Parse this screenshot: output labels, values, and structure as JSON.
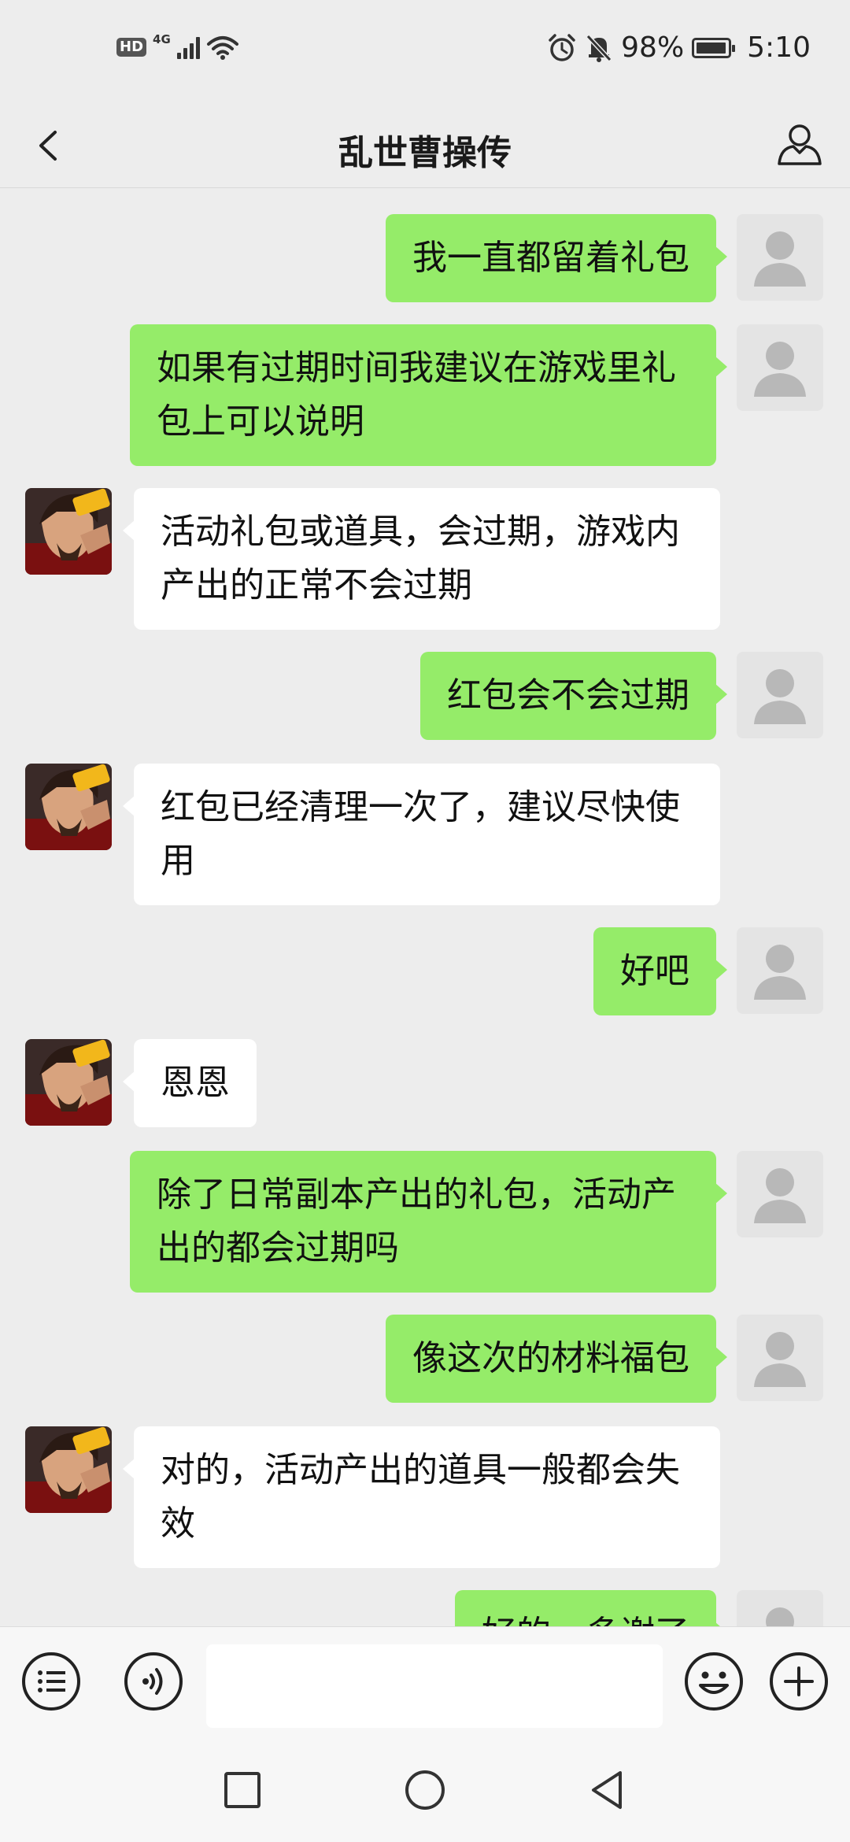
{
  "status_bar": {
    "left_badges": [
      "HD",
      "4G"
    ],
    "battery_percent": "98%",
    "battery_level": 0.98,
    "time": "5:10",
    "icons": [
      "alarm-icon",
      "mute-bell-icon",
      "wifi-icon",
      "signal-icon"
    ]
  },
  "header": {
    "title": "乱世曹操传",
    "back_icon": "chevron-left-icon",
    "profile_icon": "person-icon"
  },
  "messages": [
    {
      "sender": "me",
      "text": "我一直都留着礼包"
    },
    {
      "sender": "me",
      "text": "如果有过期时间我建议在游戏里礼包上可以说明"
    },
    {
      "sender": "bot",
      "text": "活动礼包或道具，会过期，游戏内产出的正常不会过期"
    },
    {
      "sender": "me",
      "text": "红包会不会过期"
    },
    {
      "sender": "bot",
      "text": "红包已经清理一次了，建议尽快使用"
    },
    {
      "sender": "me",
      "text": "好吧"
    },
    {
      "sender": "bot",
      "text": "恩恩"
    },
    {
      "sender": "me",
      "text": "除了日常副本产出的礼包，活动产出的都会过期吗"
    },
    {
      "sender": "me",
      "text": "像这次的材料福包"
    },
    {
      "sender": "bot",
      "text": "对的，活动产出的道具一般都会失效"
    },
    {
      "sender": "me",
      "text": "好的，多谢了"
    }
  ],
  "input_bar": {
    "menu_icon": "list-menu-icon",
    "voice_icon": "voice-icon",
    "emoji_icon": "smiley-icon",
    "plus_icon": "plus-icon",
    "text_value": ""
  },
  "nav_bar": {
    "icons": [
      "square-recents-icon",
      "circle-home-icon",
      "triangle-back-icon"
    ]
  },
  "colors": {
    "my_bubble": "#95ec69",
    "bot_bubble": "#ffffff",
    "background": "#ededed"
  }
}
